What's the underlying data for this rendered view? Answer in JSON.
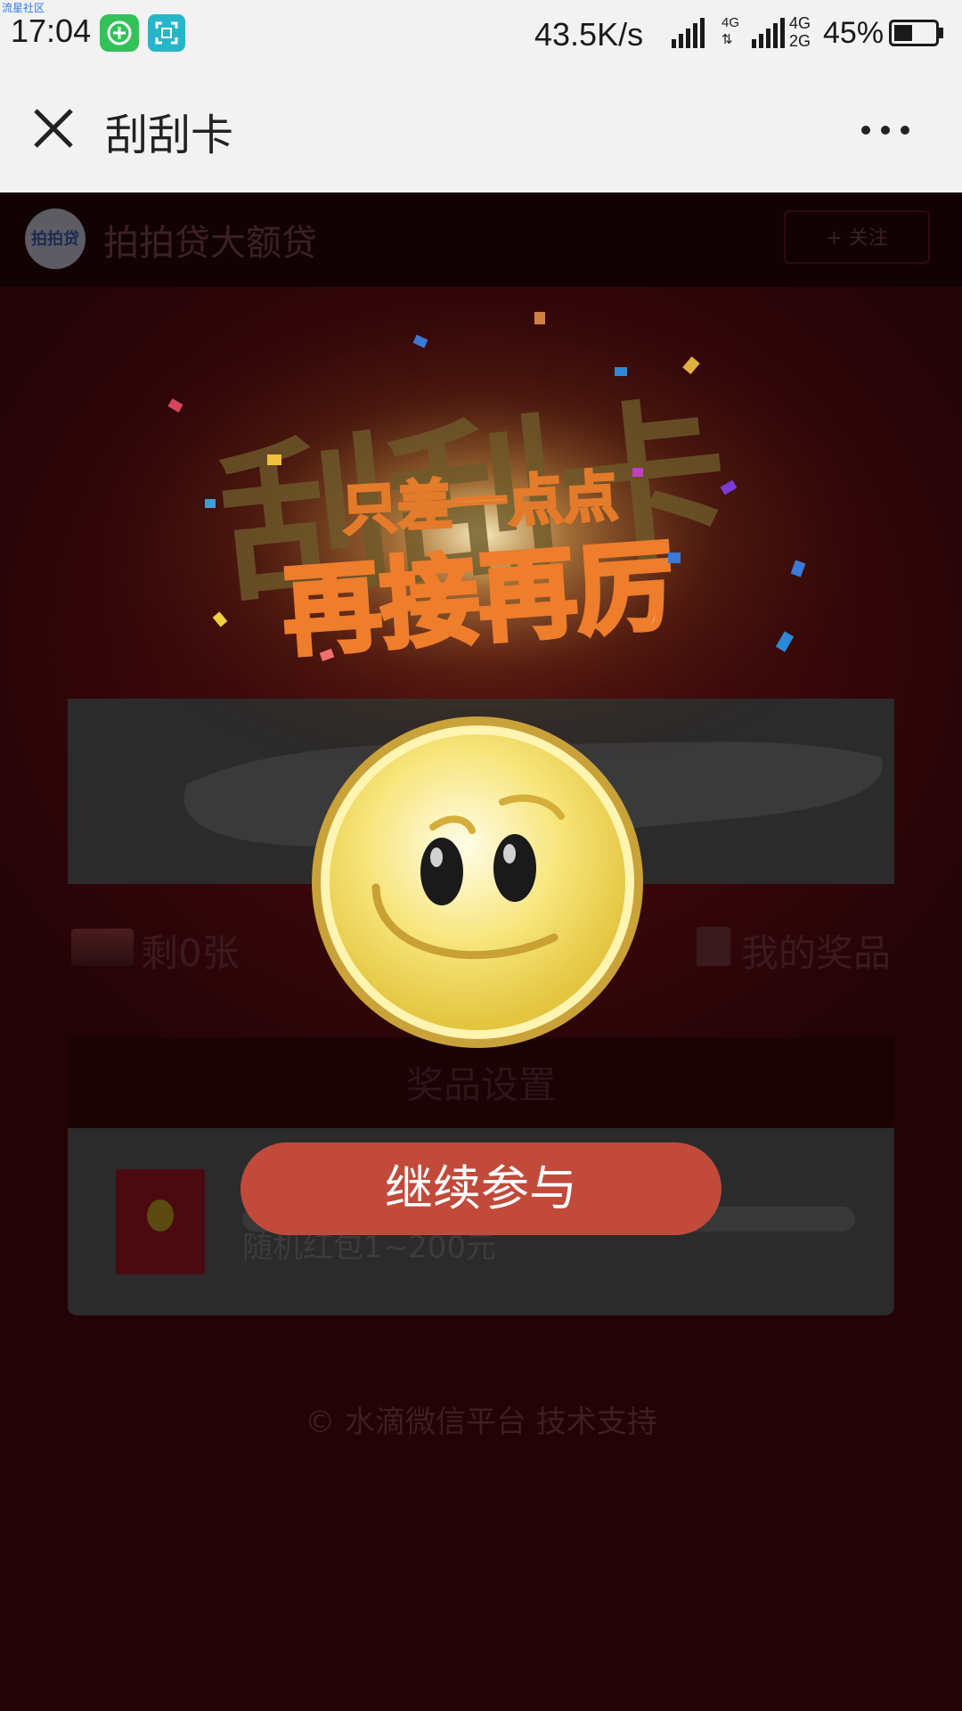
{
  "status_bar": {
    "watermark": "流星社区",
    "time": "17:04",
    "net_speed": "43.5K/s",
    "net_type_1": "4G",
    "net_type_2a": "4G",
    "net_type_2b": "2G",
    "battery_percent": "45%",
    "battery_level": 0.45
  },
  "title_bar": {
    "title": "刮刮卡"
  },
  "page": {
    "account_name": "拍拍贷大额贷",
    "avatar_text": "拍拍贷",
    "follow_label": "+ 关注",
    "remaining_label": "剩0张",
    "my_prizes_label": "我的奖品",
    "settings_label": "奖品设置",
    "prize_name": "随机红包1~200元",
    "footer": "© 水滴微信平台 技术支持"
  },
  "modal": {
    "bg_title": "刮刮卡",
    "subtitle": "只差一点点",
    "headline": "再接再厉",
    "continue_label": "继续参与"
  },
  "colors": {
    "accent_button": "#c14a3b",
    "page_bg": "#220307",
    "status_bg": "#f2f2f2"
  }
}
